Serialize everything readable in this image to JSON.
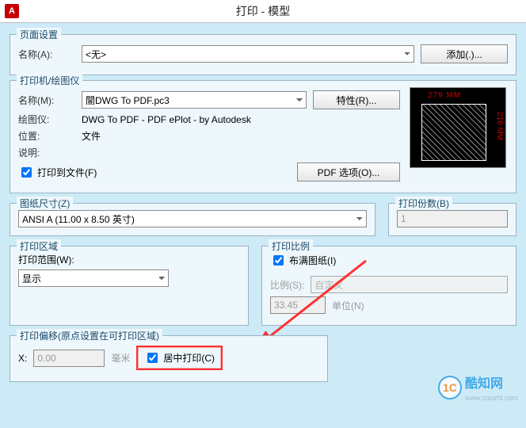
{
  "window": {
    "title": "打印 - 模型",
    "app_icon": "A"
  },
  "page_setup": {
    "legend": "页面设置",
    "name_label": "名称(A):",
    "name_value": "<无>",
    "add_btn": "添加(.)..."
  },
  "printer": {
    "legend": "打印机/绘图仪",
    "name_label": "名称(M):",
    "name_value": "闓DWG To PDF.pc3",
    "props_btn": "特性(R)...",
    "plotter_label": "绘图仪:",
    "plotter_value": "DWG To PDF - PDF ePlot - by Autodesk",
    "where_label": "位置:",
    "where_value": "文件",
    "desc_label": "说明:",
    "desc_value": "",
    "print_to_file_label": "打印到文件(F)",
    "print_to_file_checked": true,
    "pdf_btn": "PDF 选项(O)...",
    "preview": {
      "dim_top": "279 MM",
      "dim_right": "216 MM"
    }
  },
  "paper": {
    "legend": "图纸尺寸(Z)",
    "value": "ANSI A (11.00 x 8.50 英寸)"
  },
  "copies": {
    "legend": "打印份数(B)",
    "value": "1"
  },
  "area": {
    "legend": "打印区域",
    "range_label": "打印范围(W):",
    "range_value": "显示"
  },
  "scale": {
    "legend": "打印比例",
    "fit_label": "布满图纸(I)",
    "fit_checked": true,
    "scale_label": "比例(S):",
    "scale_value": "自定义",
    "units_value": "33.45",
    "units_label": "单位(N)"
  },
  "offset": {
    "legend": "打印偏移(原点设置在可打印区域)",
    "x_label": "X:",
    "x_value": "0.00",
    "x_unit": "毫米",
    "center_label": "居中打印(C)",
    "center_checked": true
  },
  "watermark": {
    "icon_text": "1C",
    "text": "酷知网",
    "sub": "www.coozhi.com"
  }
}
